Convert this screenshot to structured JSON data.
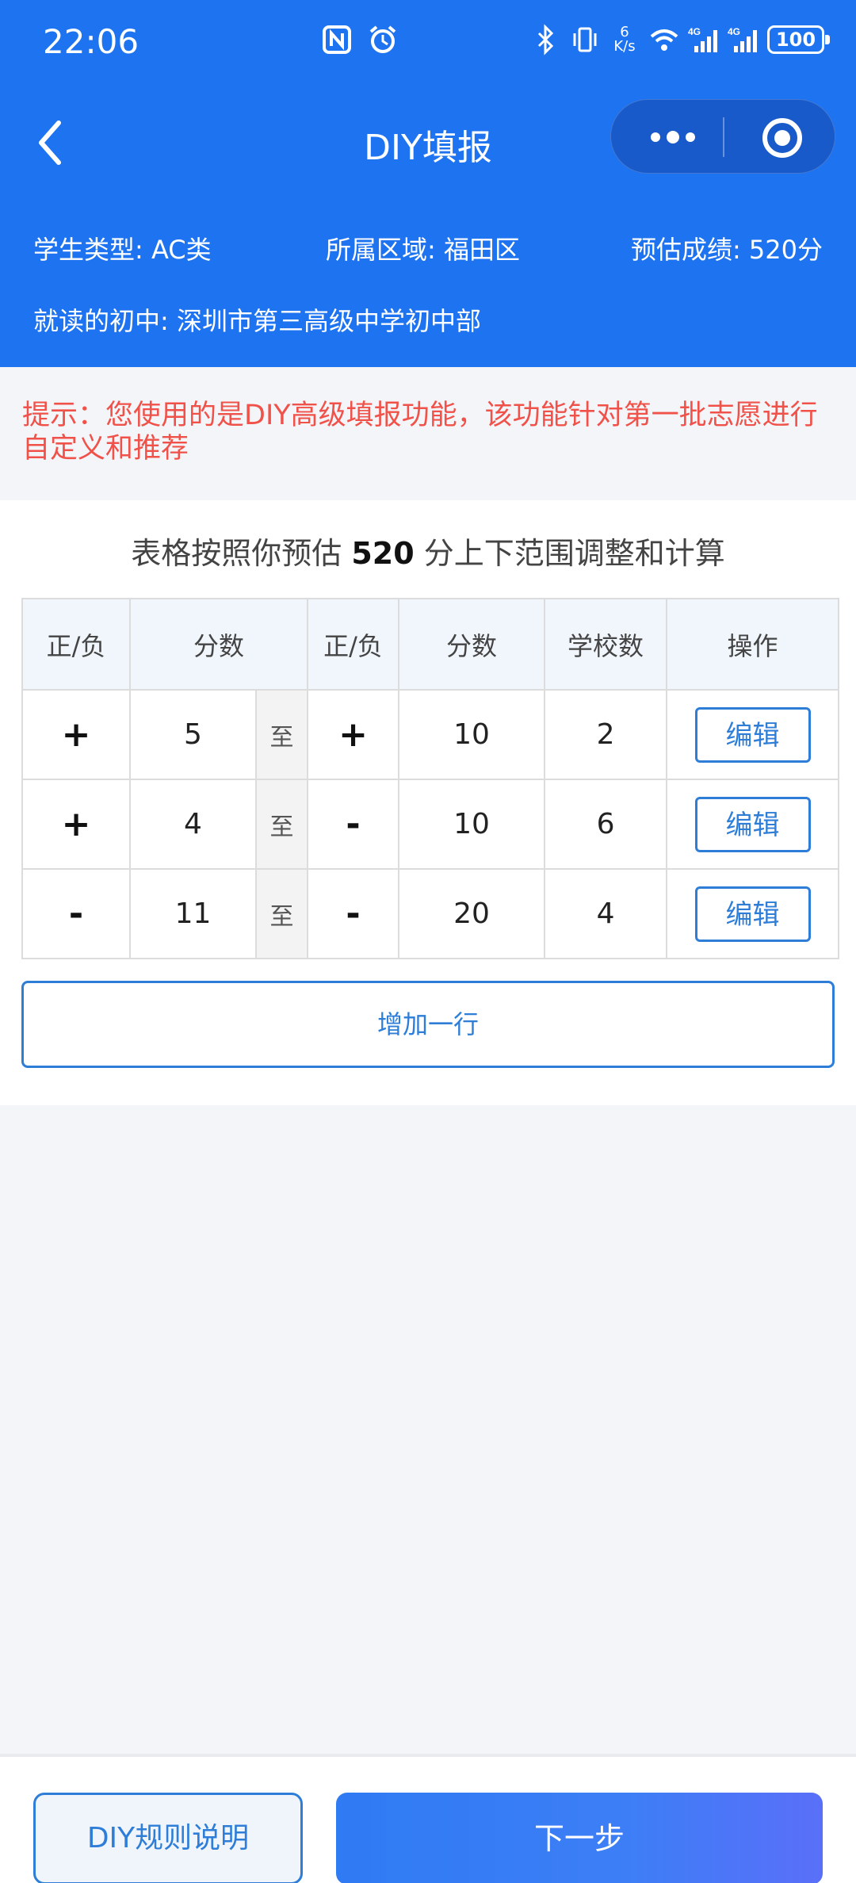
{
  "status_bar": {
    "time": "22:06",
    "net_speed_value": "6",
    "net_speed_unit": "K/s",
    "battery": "100",
    "icons": [
      "nfc-icon",
      "alarm-icon",
      "bluetooth-icon",
      "vibrate-icon",
      "wifi-icon",
      "signal-4g-icon",
      "signal-4g-icon"
    ]
  },
  "nav": {
    "title": "DIY填报"
  },
  "info": {
    "student_type": "学生类型: AC类",
    "district": "所属区域: 福田区",
    "estimated_score": "预估成绩: 520分",
    "middle_school": "就读的初中:  深圳市第三高级中学初中部"
  },
  "notice": "提示：您使用的是DIY高级填报功能，该功能针对第一批志愿进行自定义和推荐",
  "subtitle": {
    "prefix": "表格按照你预估",
    "score": "520",
    "suffix": "分上下范围调整和计算"
  },
  "table": {
    "headers": [
      "正/负",
      "分数",
      "正/负",
      "分数",
      "学校数",
      "操作"
    ],
    "to_label": "至",
    "rows": [
      {
        "sign1": "+",
        "score1": "5",
        "sign2": "+",
        "score2": "10",
        "schools": "2",
        "action": "编辑"
      },
      {
        "sign1": "+",
        "score1": "4",
        "sign2": "-",
        "score2": "10",
        "schools": "6",
        "action": "编辑"
      },
      {
        "sign1": "-",
        "score1": "11",
        "sign2": "-",
        "score2": "20",
        "schools": "4",
        "action": "编辑"
      }
    ]
  },
  "add_row_label": "增加一行",
  "bottom": {
    "rules_label": "DIY规则说明",
    "next_label": "下一步"
  },
  "colors": {
    "primary": "#1e73f0",
    "accent": "#2e7ed8",
    "notice": "#f0524a"
  }
}
